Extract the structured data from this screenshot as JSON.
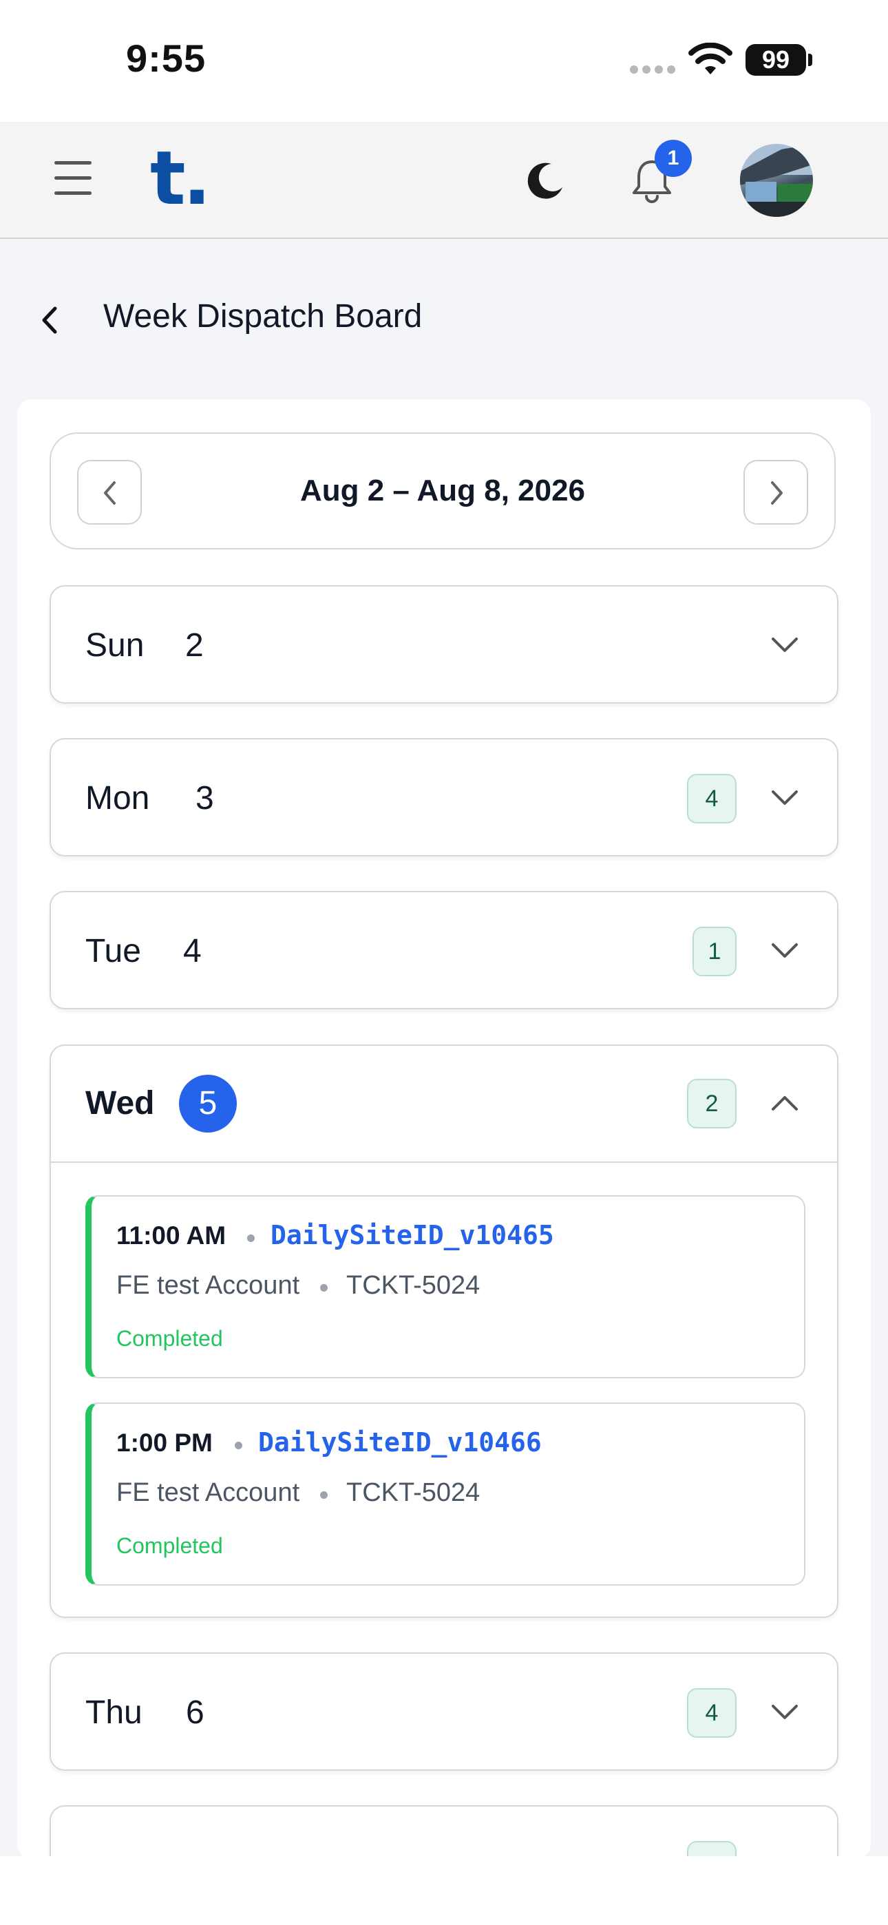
{
  "status_bar": {
    "time": "9:55",
    "battery": "99"
  },
  "app_bar": {
    "logo": "t",
    "logo_dot": ".",
    "notification_count": "1"
  },
  "page": {
    "title": "Week Dispatch Board"
  },
  "week_nav": {
    "range": "Aug 2 – Aug 8, 2026"
  },
  "days": [
    {
      "name": "Sun",
      "number": "2",
      "count": ""
    },
    {
      "name": "Mon",
      "number": "3",
      "count": "4"
    },
    {
      "name": "Tue",
      "number": "4",
      "count": "1"
    },
    {
      "name": "Wed",
      "number": "5",
      "count": "2"
    },
    {
      "name": "Thu",
      "number": "6",
      "count": "4"
    }
  ],
  "wednesday_tickets": [
    {
      "time": "11:00 AM",
      "site_id": "DailySiteID_v10465",
      "account": "FE test Account",
      "ticket": "TCKT-5024",
      "status": "Completed"
    },
    {
      "time": "1:00 PM",
      "site_id": "DailySiteID_v10466",
      "account": "FE test Account",
      "ticket": "TCKT-5024",
      "status": "Completed"
    }
  ],
  "colors": {
    "accent": "#2563eb",
    "logo": "#0b4ea2",
    "completed": "#22c55e",
    "badge_bg": "#e7f5ef"
  }
}
